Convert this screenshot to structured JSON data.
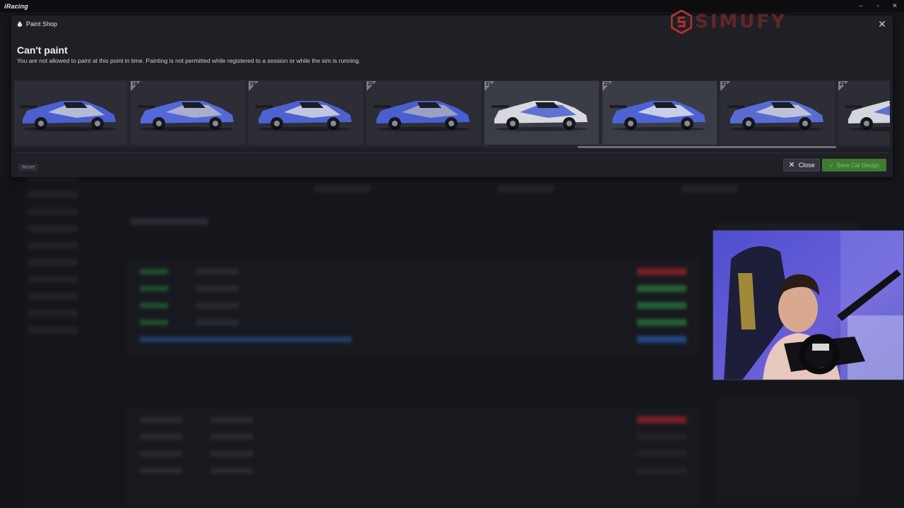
{
  "app": {
    "logo_text": "iRacing",
    "window_controls": [
      "–",
      "▫",
      "✕"
    ]
  },
  "modal": {
    "title": "Paint Shop",
    "heading": "Can't paint",
    "message": "You are not allowed to paint at this point in time. Painting is not permitted while registered to a session or while the sim is running.",
    "reset_label": "Reset",
    "close_label": "Close",
    "save_label": "Save Car Design"
  },
  "liveries": [
    {
      "number": "",
      "body_color": "#4a5fd0",
      "accent_color": "#c9cbd6"
    },
    {
      "number": "18",
      "body_color": "#5468d8",
      "accent_color": "#b9bcc8"
    },
    {
      "number": "19",
      "body_color": "#4d62cf",
      "accent_color": "#d6d8e0"
    },
    {
      "number": "20",
      "body_color": "#4a5fcf",
      "accent_color": "#a9adbd"
    },
    {
      "number": "21",
      "body_color": "#d8d9de",
      "accent_color": "#4a5fcf"
    },
    {
      "number": "22",
      "body_color": "#4d63d3",
      "accent_color": "#e0e1e6"
    },
    {
      "number": "23",
      "body_color": "#5a6cd4",
      "accent_color": "#cfd1d9"
    },
    {
      "number": "24",
      "body_color": "#d4d6dd",
      "accent_color": "#4a5fcf"
    }
  ],
  "selected_livery_number": "21",
  "colors": {
    "save_green": "#3f7c32",
    "overlay_logo": "#b23030"
  },
  "watermark": {
    "text": "SIMUFY"
  }
}
